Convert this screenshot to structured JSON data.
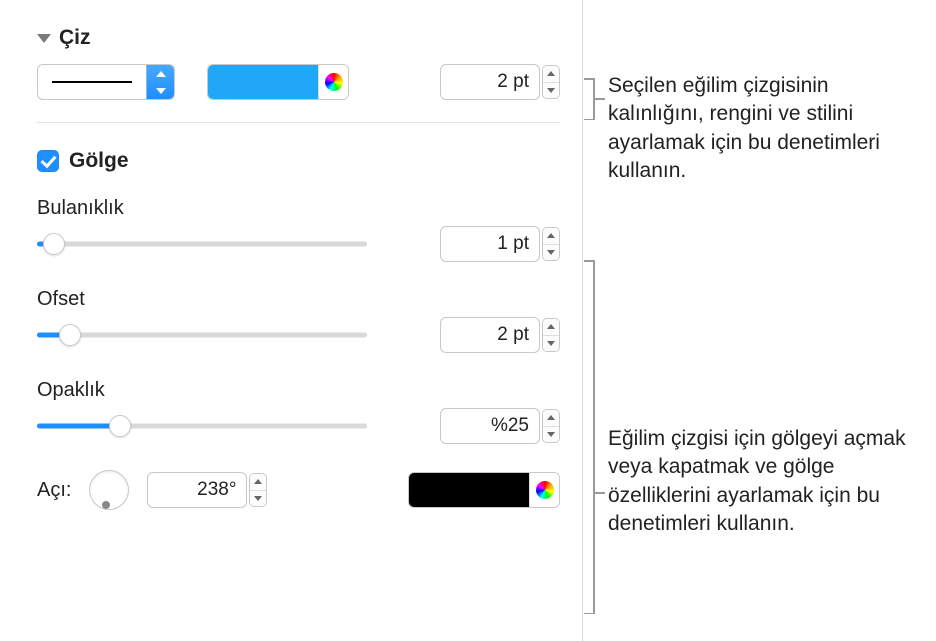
{
  "ciz": {
    "title": "Çiz",
    "thickness_value": "2 pt",
    "stroke_color": "#21a7f7"
  },
  "golge": {
    "label": "Gölge",
    "checked": true,
    "bulaniklik": {
      "label": "Bulanıklık",
      "value": "1 pt",
      "slider_pct": 5
    },
    "ofset": {
      "label": "Ofset",
      "value": "2 pt",
      "slider_pct": 10
    },
    "opaklik": {
      "label": "Opaklık",
      "value": "%25",
      "slider_pct": 25
    },
    "aci": {
      "label": "Açı:",
      "value": "238°"
    },
    "shadow_color": "#000000"
  },
  "annotations": {
    "a1": "Seçilen eğilim çizgisinin kalınlığını, rengini ve stilini ayarlamak için bu denetimleri kullanın.",
    "a2": "Eğilim çizgisi için gölgeyi açmak veya kapatmak ve gölge özelliklerini ayarlamak için bu denetimleri kullanın."
  }
}
